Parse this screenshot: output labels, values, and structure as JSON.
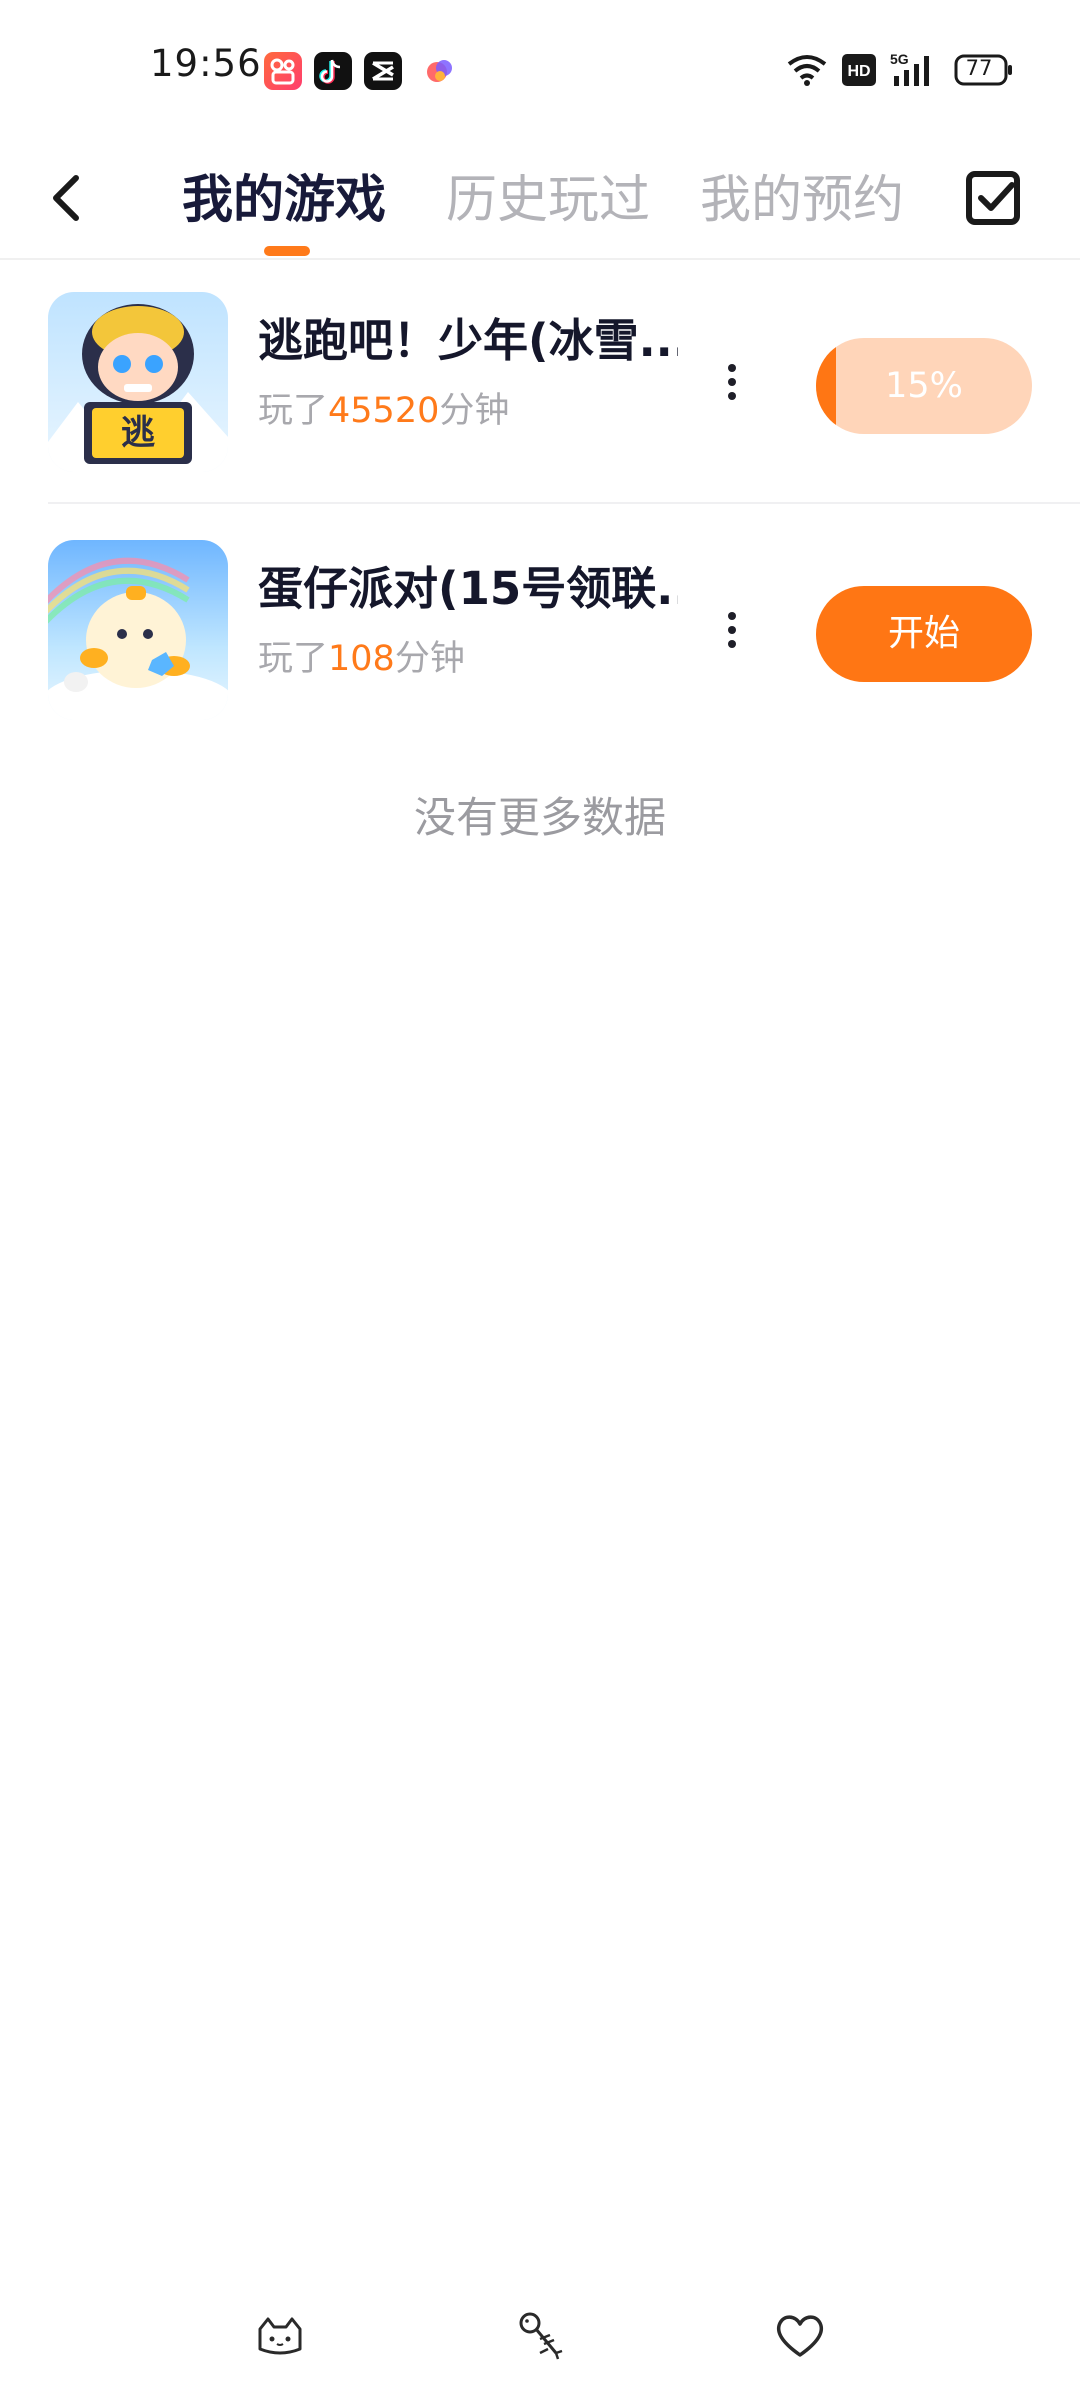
{
  "status_bar": {
    "time": "19:56",
    "battery": "77",
    "network": "5G",
    "hd_badge": "HD",
    "app_icons": [
      "kuaishou-icon",
      "douyin-icon",
      "capcut-icon",
      "game-center-icon"
    ]
  },
  "header": {
    "tabs": [
      {
        "label": "我的游戏",
        "active": true
      },
      {
        "label": "历史玩过",
        "active": false
      },
      {
        "label": "我的预约",
        "active": false
      }
    ],
    "icons": {
      "back": "back-arrow-icon",
      "edit": "checkbox-icon"
    }
  },
  "games": [
    {
      "title": "逃跑吧！少年(冰雪...",
      "playtime_prefix": "玩了",
      "playtime_value": "45520",
      "playtime_unit": "分钟",
      "action_label": "15%",
      "progress": 0.15
    },
    {
      "title": "蛋仔派对(15号领联...",
      "playtime_prefix": "玩了",
      "playtime_value": "108",
      "playtime_unit": "分钟",
      "action_label": "开始"
    }
  ],
  "footer_text": "没有更多数据",
  "bottom_bar": {
    "icons": [
      "cat-icon",
      "fishbone-icon",
      "heart-icon"
    ]
  },
  "colors": {
    "accent": "#ff7614",
    "accent_light": "#ffd5b9",
    "title_text": "#15172b",
    "muted_text": "#a8a8ad"
  }
}
